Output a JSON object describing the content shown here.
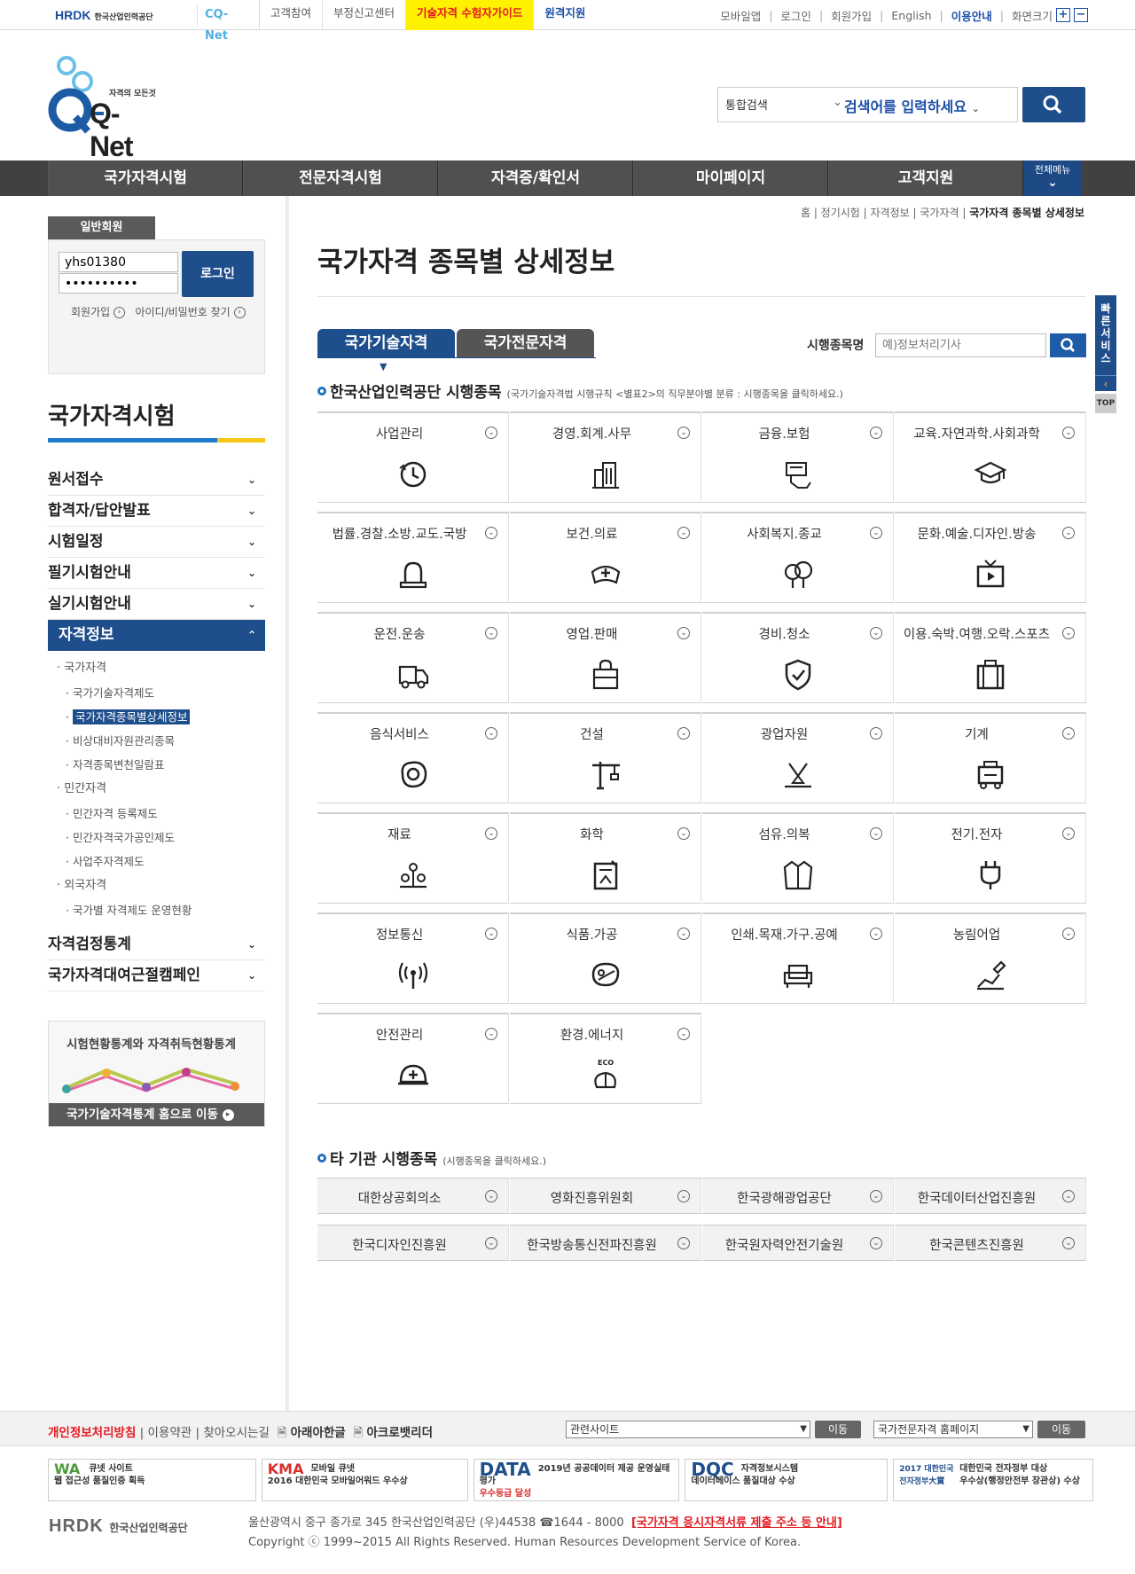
{
  "topbar": {
    "hrdk_logo": "HRDK",
    "hrdk_logo_sub": "한국산업인력공단",
    "cq_logo": "CQ-Net",
    "links": [
      "고객참여",
      "부정신고센터",
      "기술자격 수험자가이드",
      "원격지원"
    ],
    "util": [
      "모바일앱",
      "로그인",
      "회원가입",
      "English",
      "이용안내",
      "화면크기"
    ],
    "zoom_in": "+",
    "zoom_out": "−"
  },
  "header": {
    "logo_tagline": "자격의 모든것",
    "logo_text": "Q-Net",
    "search_scope": "통합검색",
    "search_placeholder": "검색어를 입력하세요"
  },
  "gnb": {
    "items": [
      "국가자격시험",
      "전문자격시험",
      "자격증/확인서",
      "마이페이지",
      "고객지원"
    ],
    "all_menu": "전체메뉴"
  },
  "login": {
    "header": "일반회원",
    "user_id": "yhs01380",
    "password": "••••••••••",
    "button": "로그인",
    "join": "회원가입",
    "find": "아이디/비밀번호 찾기"
  },
  "lnb": {
    "title": "국가자격시험",
    "menu": [
      "원서접수",
      "합격자/답안발표",
      "시험일정",
      "필기시험안내",
      "실기시험안내"
    ],
    "active": "자격정보",
    "sub": {
      "national": "국가자격",
      "national_items": [
        "국가기술자격제도",
        "국가자격종목별상세정보",
        "비상대비자원관리종목",
        "자격종목변천일람표"
      ],
      "private": "민간자격",
      "private_items": [
        "민간자격 등록제도",
        "민간자격국가공인제도",
        "사업주자격제도"
      ],
      "foreign": "외국자격",
      "foreign_items": [
        "국가별 자격제도 운영현황"
      ]
    },
    "after": [
      "자격검정통계",
      "국가자격대여근절캠페인"
    ]
  },
  "statbox": {
    "title": "시험현황통계와 자격취득현황통계",
    "button": "국가기술자격통계 홈으로 이동"
  },
  "breadcrumb": [
    "홈",
    "정기시험",
    "자격정보",
    "국가자격",
    "국가자격 종목별 상세정보"
  ],
  "page_title": "국가자격 종목별 상세정보",
  "tabs": [
    "국가기술자격",
    "국가전문자격"
  ],
  "search": {
    "label": "시행종목명",
    "placeholder": "예)정보처리기사"
  },
  "section1": {
    "title": "한국산업인력공단 시행종목",
    "note": "(국가기술자격법 시행규칙 <별표2>의 직무분야별 분류 : 시행종목을 클릭하세요.)"
  },
  "categories": [
    {
      "label": "사업관리",
      "icon": "clock-icon"
    },
    {
      "label": "경영.회계.사무",
      "icon": "building-chart-icon"
    },
    {
      "label": "금융.보험",
      "icon": "money-hand-icon"
    },
    {
      "label": "교육.자연과학.사회과학",
      "icon": "graduation-cap-icon"
    },
    {
      "label": "법률.경찰.소방.교도.국방",
      "icon": "siren-icon"
    },
    {
      "label": "보건.의료",
      "icon": "medical-cap-icon"
    },
    {
      "label": "사회복지.종교",
      "icon": "trees-icon"
    },
    {
      "label": "문화.예술.디자인.방송",
      "icon": "tv-play-icon"
    },
    {
      "label": "운전.운송",
      "icon": "truck-icon"
    },
    {
      "label": "영업.판매",
      "icon": "shopping-bag-icon"
    },
    {
      "label": "경비.청소",
      "icon": "shield-check-icon"
    },
    {
      "label": "이용.숙박.여행.오락.스포츠",
      "icon": "suitcase-icon"
    },
    {
      "label": "음식서비스",
      "icon": "fried-egg-icon"
    },
    {
      "label": "건설",
      "icon": "crane-icon"
    },
    {
      "label": "광업자원",
      "icon": "mining-icon"
    },
    {
      "label": "기계",
      "icon": "machine-icon"
    },
    {
      "label": "재료",
      "icon": "materials-icon"
    },
    {
      "label": "화학",
      "icon": "chemistry-icon"
    },
    {
      "label": "섬유.의복",
      "icon": "jacket-icon"
    },
    {
      "label": "전기.전자",
      "icon": "plug-icon"
    },
    {
      "label": "정보통신",
      "icon": "antenna-icon"
    },
    {
      "label": "식품.가공",
      "icon": "meat-icon"
    },
    {
      "label": "인쇄.목재.가구.공예",
      "icon": "sofa-icon"
    },
    {
      "label": "농림어업",
      "icon": "shovel-icon"
    },
    {
      "label": "안전관리",
      "icon": "helmet-icon"
    },
    {
      "label": "환경.에너지",
      "icon": "eco-leaf-icon"
    }
  ],
  "eco_text": "ECO",
  "section2": {
    "title": "타 기관 시행종목",
    "note": "(시행종목을 클릭하세요.)"
  },
  "others": [
    "대한상공회의소",
    "영화진흥위원회",
    "한국광해광업공단",
    "한국데이터산업진흥원",
    "한국디자인진흥원",
    "한국방송통신전파진흥원",
    "한국원자력안전기술원",
    "한국콘텐츠진흥원"
  ],
  "quick": {
    "label": "빠른서비스",
    "top": "TOP"
  },
  "footer": {
    "links": [
      "개인정보처리방침",
      "이용약관",
      "찾아오시는길",
      "아래아한글",
      "아크로뱃리더"
    ],
    "site_select": "관련사이트",
    "site_go": "이동",
    "pro_select": "국가전문자격 홈페이지",
    "pro_go": "이동",
    "awards": [
      {
        "title": "큐넷 사이트",
        "text": "웹 접근성 품질인증 획득",
        "badge": "WA"
      },
      {
        "title": "모바일 큐넷",
        "text": "2016 대한민국 모바일어워드 우수상",
        "badge": "KMA"
      },
      {
        "title": "2019년 공공데이터 제공 운영실태 평가",
        "text": "우수등급 달성",
        "badge": "DATA"
      },
      {
        "title": "자격정보시스템",
        "text": "데이터베이스 품질대상 수상",
        "badge": "DQC"
      },
      {
        "title": "대한민국 전자정부 대상",
        "text": "우수상(행정안전부 장관상) 수상",
        "badge": "2017 대한민국 전자정부大賞"
      }
    ],
    "hrdk": "HRDK",
    "hrdk_sub": "한국산업인력공단",
    "address": "울산광역시 중구 종가로 345 한국산업인력공단 (우)44538 ☎1644 - 8000",
    "notice": "[국가자격 응시자격서류 제출 주소 등 안내]",
    "copyright": "Copyright ⓒ 1999~2015 All Rights Reserved. Human Resources Development Service of Korea."
  }
}
